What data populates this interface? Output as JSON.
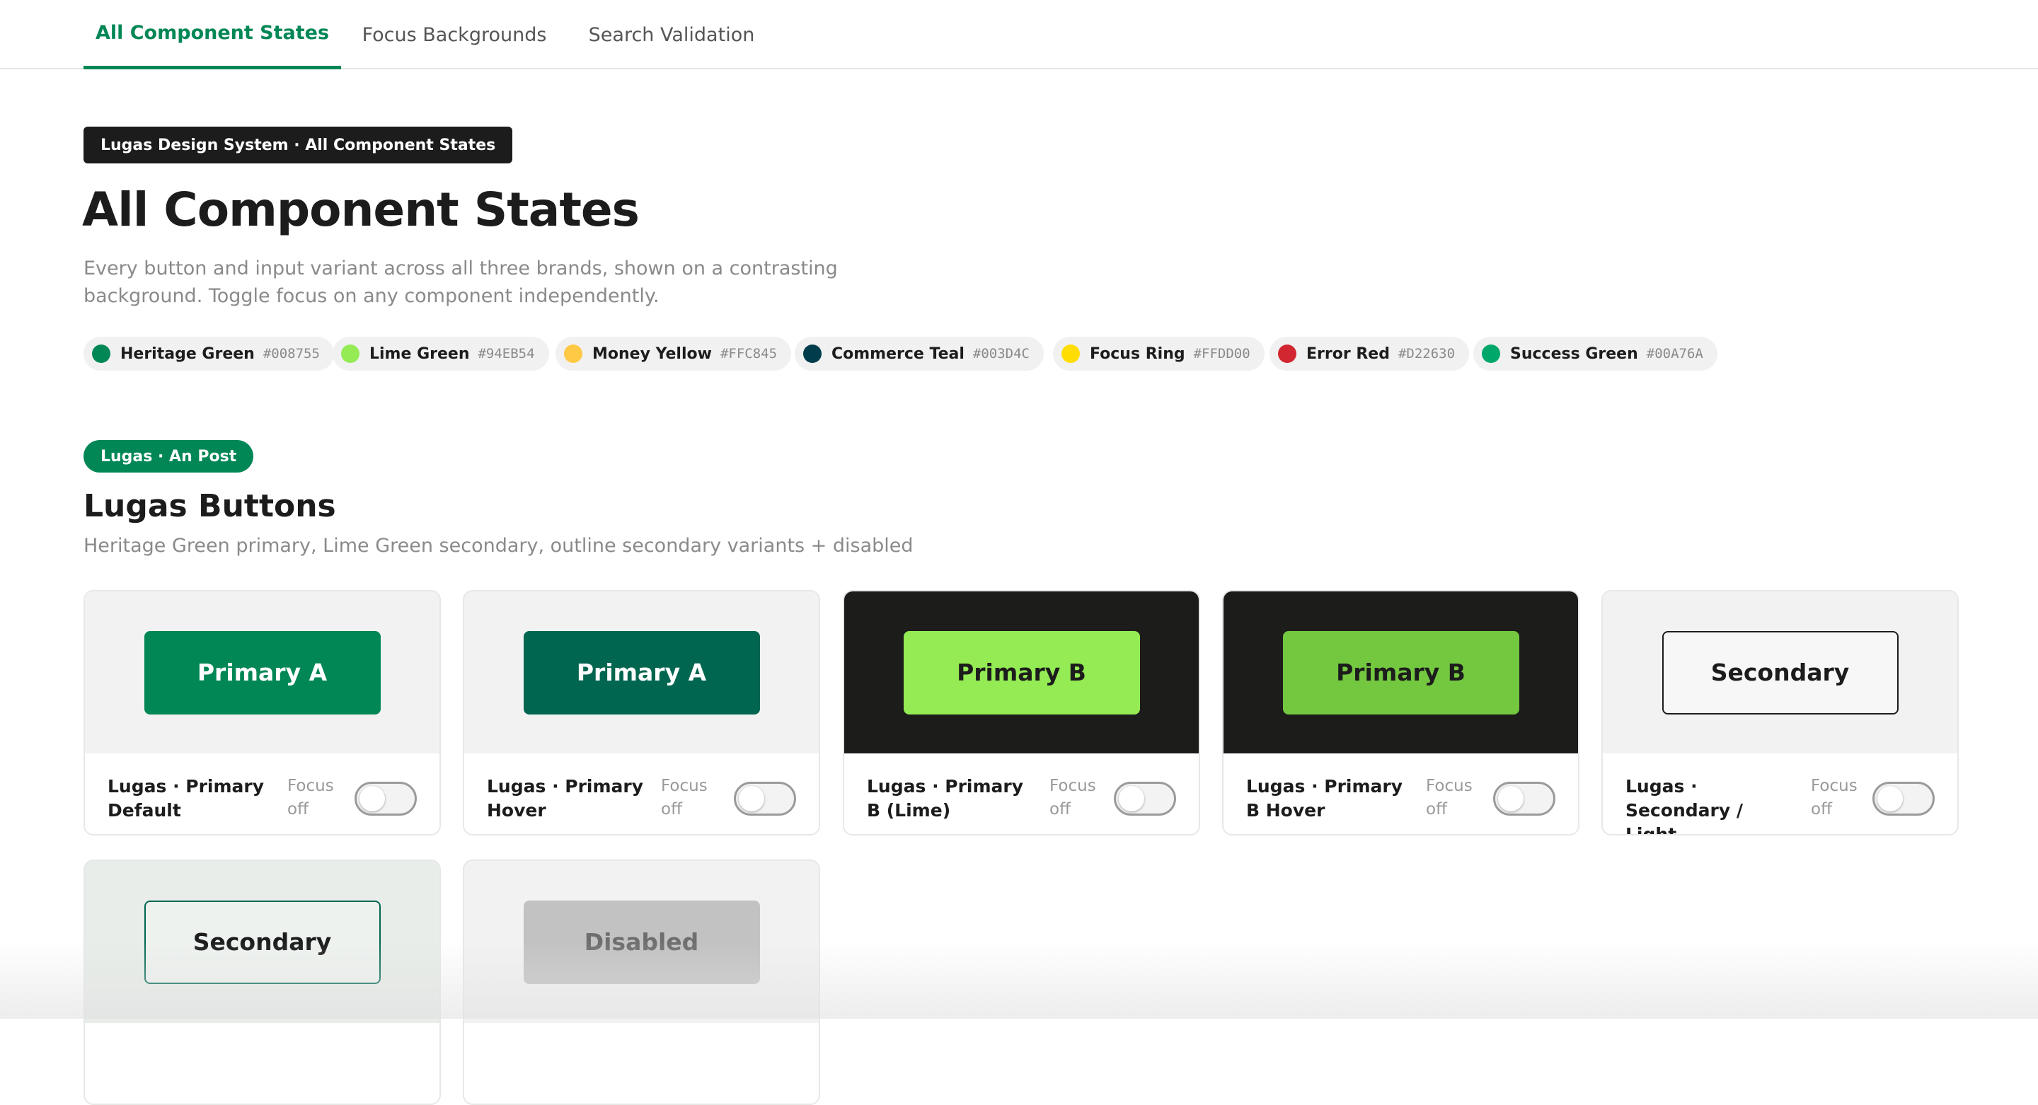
{
  "tabs": [
    {
      "label": "All Component States",
      "active": true
    },
    {
      "label": "Focus Backgrounds",
      "active": false
    },
    {
      "label": "Search Validation",
      "active": false
    }
  ],
  "header": {
    "eyebrow": "Lugas Design System · All Component States",
    "title": "All Component States",
    "description": "Every button and input variant across all three brands, shown on a contrasting background. Toggle focus on any component independently."
  },
  "swatches": [
    {
      "name": "Heritage Green",
      "hex": "#008755",
      "color": "#008755"
    },
    {
      "name": "Lime Green",
      "hex": "#94EB54",
      "color": "#94EB54"
    },
    {
      "name": "Money Yellow",
      "hex": "#FFC845",
      "color": "#FFC845"
    },
    {
      "name": "Commerce Teal",
      "hex": "#003D4C",
      "color": "#003D4C"
    },
    {
      "name": "Focus Ring",
      "hex": "#FFDD00",
      "color": "#FFDD00"
    },
    {
      "name": "Error Red",
      "hex": "#D22630",
      "color": "#D22630"
    },
    {
      "name": "Success Green",
      "hex": "#00A76A",
      "color": "#00A76A"
    }
  ],
  "section": {
    "brand": "Lugas · An Post",
    "title": "Lugas Buttons",
    "description": "Heritage Green primary, Lime Green secondary, outline secondary variants + disabled"
  },
  "cards": [
    {
      "button": "Primary A",
      "label": "Lugas · Primary Default",
      "focus": "Focus off"
    },
    {
      "button": "Primary A",
      "label": "Lugas · Primary Hover",
      "focus": "Focus off"
    },
    {
      "button": "Primary B",
      "label": "Lugas · Primary B (Lime)",
      "focus": "Focus off"
    },
    {
      "button": "Primary B",
      "label": "Lugas · Primary B Hover",
      "focus": "Focus off"
    },
    {
      "button": "Secondary",
      "label": "Lugas · Secondary / Light",
      "focus": "Focus off"
    },
    {
      "button": "Secondary"
    },
    {
      "button": "Disabled"
    }
  ],
  "colors": {
    "heritage_green": "#008755",
    "heritage_green_hover": "#006650",
    "lime_green": "#94EB54",
    "lime_green_hover": "#74C840",
    "dark_stage": "#1C1D1B",
    "light_stage": "#F2F2F2",
    "tinted_stage": "#E8EDE9",
    "disabled_bg": "#C2C2C2",
    "disabled_text": "#6E6E6E"
  }
}
